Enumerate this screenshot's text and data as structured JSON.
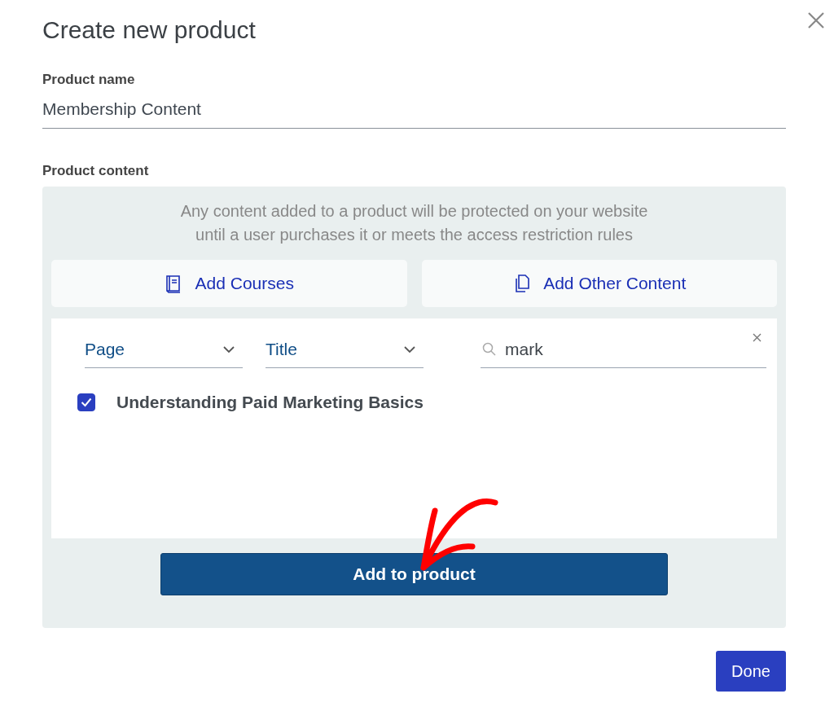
{
  "dialog": {
    "title": "Create new product"
  },
  "product_name": {
    "label": "Product name",
    "value": "Membership Content"
  },
  "product_content": {
    "label": "Product content",
    "notice_lines": [
      "Any content added to a product will be protected on your website",
      "until a user purchases it or meets the access restriction rules"
    ],
    "tabs": [
      {
        "kind": "courses",
        "label": "Add Courses"
      },
      {
        "kind": "other",
        "label": "Add Other Content"
      }
    ],
    "filters": [
      {
        "value": "Page"
      },
      {
        "value": "Title"
      }
    ],
    "search": {
      "value": "mark"
    },
    "results": [
      {
        "label": "Understanding Paid Marketing Basics",
        "checked": true
      }
    ],
    "add_button": "Add to product"
  },
  "done_button": "Done"
}
